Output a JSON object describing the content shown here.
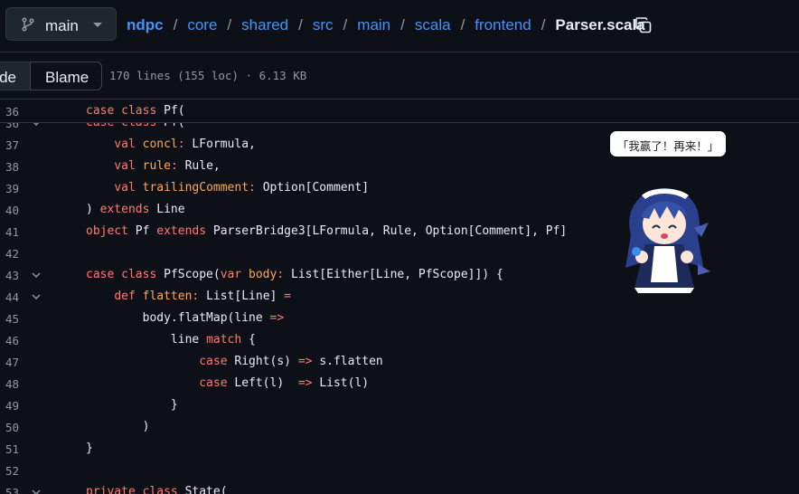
{
  "header": {
    "branch": "main",
    "breadcrumbs": [
      "ndpc",
      "core",
      "shared",
      "src",
      "main",
      "scala",
      "frontend"
    ],
    "separator": "/",
    "file_name": "Parser.scala"
  },
  "toolbar": {
    "code_tab": "de",
    "blame_tab": "Blame",
    "file_meta": "170 lines (155 loc) · 6.13 KB"
  },
  "sticky_line": {
    "number": "36",
    "tokens": [
      {
        "c": "k",
        "t": "case class "
      },
      {
        "c": "t",
        "t": "Pf("
      }
    ]
  },
  "lines": [
    {
      "number": "36",
      "fold": true,
      "tokens": [
        {
          "c": "k",
          "t": "case class "
        },
        {
          "c": "t",
          "t": "Pf("
        }
      ]
    },
    {
      "number": "37",
      "fold": false,
      "tokens": [
        {
          "c": "t",
          "t": "    "
        },
        {
          "c": "k",
          "t": "val "
        },
        {
          "c": "p",
          "t": "concl"
        },
        {
          "c": "k",
          "t": ": "
        },
        {
          "c": "t",
          "t": "LFormula,"
        }
      ]
    },
    {
      "number": "38",
      "fold": false,
      "tokens": [
        {
          "c": "t",
          "t": "    "
        },
        {
          "c": "k",
          "t": "val "
        },
        {
          "c": "p",
          "t": "rule"
        },
        {
          "c": "k",
          "t": ": "
        },
        {
          "c": "t",
          "t": "Rule,"
        }
      ]
    },
    {
      "number": "39",
      "fold": false,
      "tokens": [
        {
          "c": "t",
          "t": "    "
        },
        {
          "c": "k",
          "t": "val "
        },
        {
          "c": "p",
          "t": "trailingComment"
        },
        {
          "c": "k",
          "t": ": "
        },
        {
          "c": "t",
          "t": "Option[Comment]"
        }
      ]
    },
    {
      "number": "40",
      "fold": false,
      "tokens": [
        {
          "c": "t",
          "t": ") "
        },
        {
          "c": "k",
          "t": "extends "
        },
        {
          "c": "t",
          "t": "Line"
        }
      ]
    },
    {
      "number": "41",
      "fold": false,
      "tokens": [
        {
          "c": "k",
          "t": "object "
        },
        {
          "c": "t",
          "t": "Pf "
        },
        {
          "c": "k",
          "t": "extends "
        },
        {
          "c": "t",
          "t": "ParserBridge3[LFormula, Rule, Option[Comment], Pf]"
        }
      ]
    },
    {
      "number": "42",
      "fold": false,
      "tokens": []
    },
    {
      "number": "43",
      "fold": true,
      "tokens": [
        {
          "c": "k",
          "t": "case class "
        },
        {
          "c": "t",
          "t": "PfScope("
        },
        {
          "c": "k",
          "t": "var "
        },
        {
          "c": "p",
          "t": "body"
        },
        {
          "c": "k",
          "t": ": "
        },
        {
          "c": "t",
          "t": "List[Either[Line, PfScope]]) {"
        }
      ]
    },
    {
      "number": "44",
      "fold": true,
      "tokens": [
        {
          "c": "t",
          "t": "    "
        },
        {
          "c": "k",
          "t": "def "
        },
        {
          "c": "p",
          "t": "flatten"
        },
        {
          "c": "k",
          "t": ": "
        },
        {
          "c": "t",
          "t": "List[Line] "
        },
        {
          "c": "k",
          "t": "="
        }
      ]
    },
    {
      "number": "45",
      "fold": false,
      "tokens": [
        {
          "c": "t",
          "t": "        body.flatMap(line "
        },
        {
          "c": "k",
          "t": "=>"
        }
      ]
    },
    {
      "number": "46",
      "fold": false,
      "tokens": [
        {
          "c": "t",
          "t": "            line "
        },
        {
          "c": "k",
          "t": "match "
        },
        {
          "c": "t",
          "t": "{"
        }
      ]
    },
    {
      "number": "47",
      "fold": false,
      "tokens": [
        {
          "c": "t",
          "t": "                "
        },
        {
          "c": "k",
          "t": "case "
        },
        {
          "c": "t",
          "t": "Right(s) "
        },
        {
          "c": "k",
          "t": "=> "
        },
        {
          "c": "t",
          "t": "s.flatten"
        }
      ]
    },
    {
      "number": "48",
      "fold": false,
      "tokens": [
        {
          "c": "t",
          "t": "                "
        },
        {
          "c": "k",
          "t": "case "
        },
        {
          "c": "t",
          "t": "Left(l)  "
        },
        {
          "c": "k",
          "t": "=> "
        },
        {
          "c": "t",
          "t": "List(l)"
        }
      ]
    },
    {
      "number": "49",
      "fold": false,
      "tokens": [
        {
          "c": "t",
          "t": "            }"
        }
      ]
    },
    {
      "number": "50",
      "fold": false,
      "tokens": [
        {
          "c": "t",
          "t": "        )"
        }
      ]
    },
    {
      "number": "51",
      "fold": false,
      "tokens": [
        {
          "c": "t",
          "t": "}"
        }
      ]
    },
    {
      "number": "52",
      "fold": false,
      "tokens": []
    },
    {
      "number": "53",
      "fold": true,
      "tokens": [
        {
          "c": "k",
          "t": "private class "
        },
        {
          "c": "t",
          "t": "State("
        }
      ]
    }
  ],
  "mascot": {
    "speech": "「我赢了！再来！」"
  },
  "colors": {
    "background": "#0d1117",
    "keyword": "#ff7b72",
    "param": "#ffa657",
    "link": "#4493f8",
    "muted": "#9198a1"
  }
}
